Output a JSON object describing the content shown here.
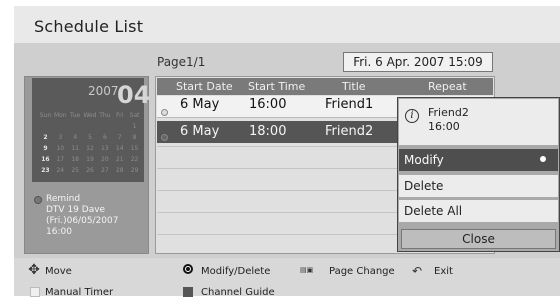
{
  "title": "Schedule List",
  "page_indicator": "Page1/1",
  "current_datetime": "Fri. 6 Apr. 2007 15:09",
  "calendar": {
    "year": "2007",
    "month": "04",
    "weekdays": [
      "Sun",
      "Mon",
      "Tue",
      "Wed",
      "Thu",
      "Fri",
      "Sat"
    ],
    "days": [
      "",
      "",
      "",
      "",
      "",
      "",
      "1",
      "2",
      "3",
      "4",
      "5",
      "6",
      "7",
      "8",
      "9",
      "10",
      "11",
      "12",
      "13",
      "14",
      "15",
      "16",
      "17",
      "18",
      "19",
      "20",
      "21",
      "22",
      "23",
      "24",
      "25",
      "26",
      "27",
      "28",
      "29"
    ],
    "remind_title": "Remind",
    "remind_text": "DTV 19 Dave\n(Fri.)06/05/2007\n16:00"
  },
  "table": {
    "headers": [
      "Start Date",
      "Start Time",
      "Title",
      "Repeat"
    ],
    "rows": [
      {
        "start_date": "6 May",
        "start_time": "16:00",
        "title": "Friend1"
      },
      {
        "start_date": "6 May",
        "start_time": "18:00",
        "title": "Friend2"
      }
    ]
  },
  "popup": {
    "info_name": "Friend2",
    "info_time": "16:00",
    "items": [
      "Modify",
      "Delete",
      "Delete All"
    ],
    "close_label": "Close"
  },
  "footer": {
    "move": "Move",
    "modify_delete": "Modify/Delete",
    "page_change": "Page Change",
    "exit": "Exit",
    "manual_timer": "Manual Timer",
    "channel_guide": "Channel Guide"
  }
}
